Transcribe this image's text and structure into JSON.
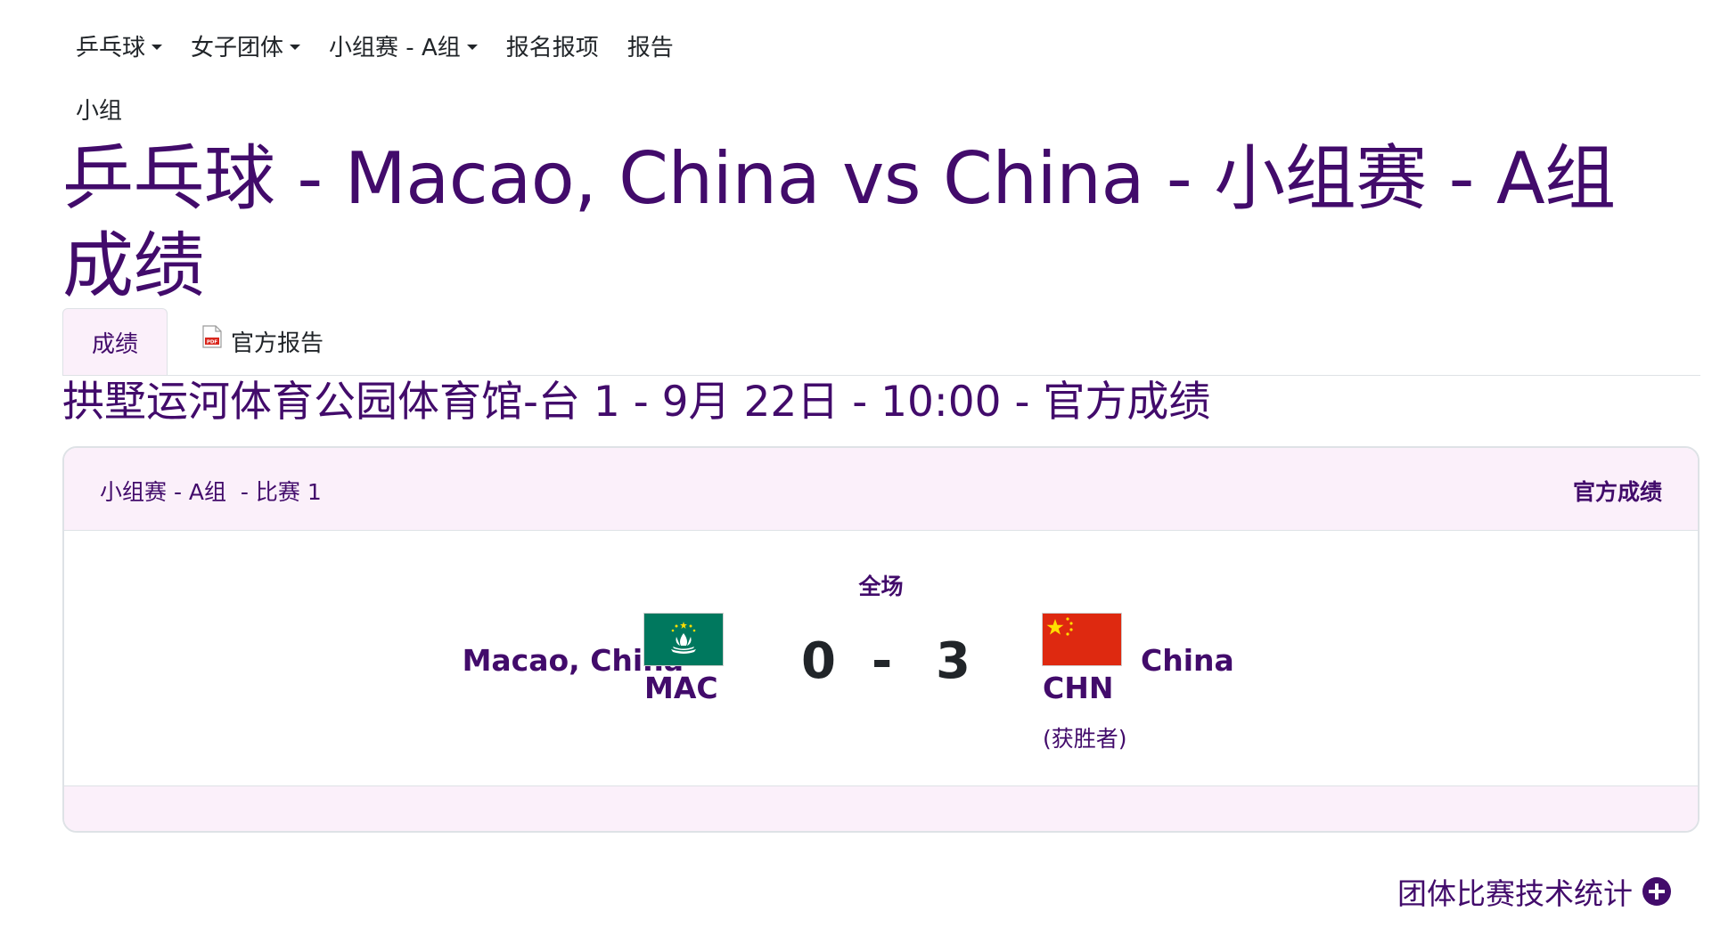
{
  "nav": {
    "items": [
      {
        "label": "乒乓球",
        "dropdown": true
      },
      {
        "label": "女子团体",
        "dropdown": true
      },
      {
        "label": "小组赛 - A组",
        "dropdown": true
      },
      {
        "label": "报名报项",
        "dropdown": false
      },
      {
        "label": "报告",
        "dropdown": false
      }
    ]
  },
  "breadcrumb": "小组",
  "page_title": "乒乓球 - Macao, China vs China - 小组赛 - A组 成绩",
  "tabs": {
    "results": "成绩",
    "official_report": "官方报告"
  },
  "venue_line": "拱墅运河体育公园体育馆-台 1 - 9月 22日 - 10:00 - 官方成绩",
  "match_card": {
    "header_left": "小组赛 - A组  - 比赛 1",
    "header_right": "官方成绩",
    "phase": "全场",
    "home": {
      "name": "Macao, China",
      "code": "MAC",
      "score": "0"
    },
    "separator": "-",
    "away": {
      "name": "China",
      "code": "CHN",
      "score": "3",
      "winner_note": "(获胜者)"
    }
  },
  "team_stats_link": "团体比赛技术统计",
  "colors": {
    "brand_purple": "#420b6b",
    "tab_bg": "#fbf0fa",
    "mac_flag_green": "#00785e",
    "chn_flag_red": "#de2910",
    "chn_flag_star": "#ffde00"
  },
  "icons": {
    "dropdown": "caret-down-icon",
    "report": "pdf-file-icon",
    "stats": "plus-circle-icon"
  }
}
